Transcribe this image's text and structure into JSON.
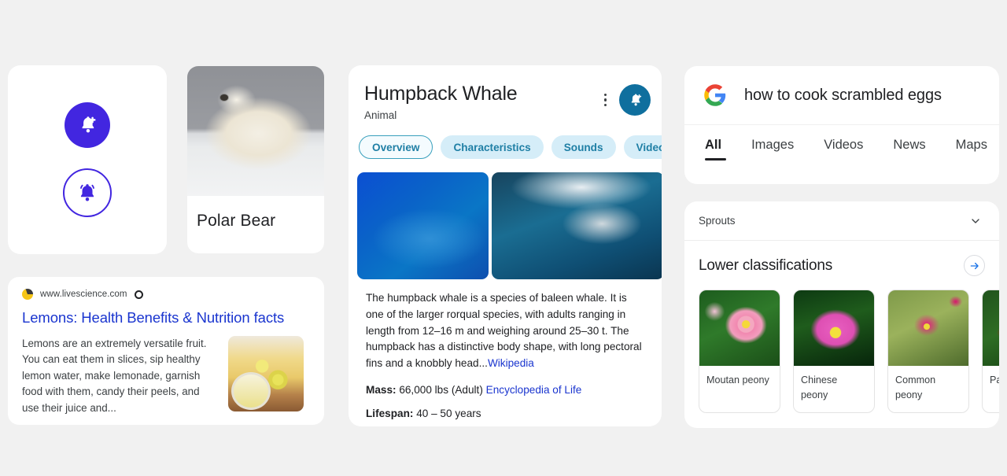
{
  "background_color": "#f1f1f1",
  "left_column": {
    "bell_card": {
      "buttons": [
        {
          "name": "notification-add-filled",
          "icon": "bell-plus-icon",
          "style": "filled",
          "color": "#4226e0"
        },
        {
          "name": "notification-active-outlined",
          "icon": "bell-ringing-icon",
          "style": "outlined",
          "color": "#4226e0"
        }
      ]
    },
    "polar_bear_card": {
      "image_alt": "polar-bear-photo",
      "caption": "Polar Bear"
    },
    "lemon_result_card": {
      "site_url": "www.livescience.com",
      "favicon": "livescience-favicon",
      "more_icon": "more-options-icon",
      "title": "Lemons: Health Benefits & Nutrition facts",
      "snippet": "Lemons are an extremely versatile fruit. You can eat them in slices, sip healthy lemon water, make lemonade, garnish food with them, candy their peels, and use their juice and...",
      "thumbnail_alt": "lemons-photo",
      "title_color": "#1a35cf"
    }
  },
  "whale_card": {
    "title": "Humpback Whale",
    "subtitle": "Animal",
    "kebab_icon": "more-vertical-icon",
    "notify_icon": "bell-plus-icon",
    "notify_color": "#0f6f9e",
    "chips": [
      {
        "label": "Overview",
        "selected": true
      },
      {
        "label": "Characteristics",
        "selected": false
      },
      {
        "label": "Sounds",
        "selected": false
      },
      {
        "label": "Videos",
        "selected": false
      }
    ],
    "images": [
      {
        "alt": "humpback-whale-underwater-blue"
      },
      {
        "alt": "humpback-whale-breaching"
      }
    ],
    "description": "The humpback whale is a species of baleen whale. It is one of the larger rorqual species, with adults ranging in length from 12–16 m and weighing around 25–30 t. The humpback has a distinctive body shape, with long pectoral fins and a knobbly head...",
    "description_source": "Wikipedia",
    "facts": [
      {
        "label": "Mass:",
        "value": "66,000 lbs (Adult)",
        "source": "Encyclopedia of Life"
      },
      {
        "label": "Lifespan:",
        "value": "40 – 50 years",
        "source": ""
      }
    ]
  },
  "right_column": {
    "search_card": {
      "logo": "google-logo-icon",
      "query": "how to cook scrambled eggs",
      "tabs": [
        {
          "label": "All",
          "active": true
        },
        {
          "label": "Images",
          "active": false
        },
        {
          "label": "Videos",
          "active": false
        },
        {
          "label": "News",
          "active": false
        },
        {
          "label": "Maps",
          "active": false
        }
      ]
    },
    "classifications_card": {
      "sprouts_label": "Sprouts",
      "sprouts_chevron": "chevron-down-icon",
      "section_title": "Lower classifications",
      "arrow_icon": "arrow-right-icon",
      "items": [
        {
          "label": "Moutan peony",
          "alt": "moutan-peony-photo"
        },
        {
          "label": "Chinese peony",
          "alt": "chinese-peony-photo"
        },
        {
          "label": "Common peony",
          "alt": "common-peony-photo"
        },
        {
          "label": "Pa ter",
          "alt": "paeonia-tenuifolia-photo"
        }
      ]
    }
  }
}
